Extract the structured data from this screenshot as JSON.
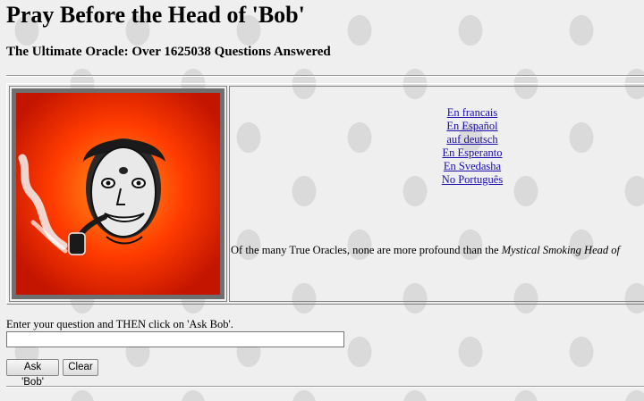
{
  "page": {
    "title": "Pray Before the Head of 'Bob'",
    "subtitle": "The Ultimate Oracle: Over 1625038 Questions Answered"
  },
  "oracle_image": {
    "icon": "smoking-bob-head",
    "colors": {
      "center": "#ff9a1e",
      "mid": "#ff3b00",
      "edge": "#c41500",
      "frame": "#6f6f6f"
    }
  },
  "languages": [
    "En francais",
    "En Español",
    "auf deutsch",
    "En Esperanto",
    "En Svedasha",
    "No Português"
  ],
  "intro": {
    "text": "Of the many True Oracles, none are more profound than the ",
    "emphasis": "Mystical Smoking Head of"
  },
  "form": {
    "prompt": "Enter your question and THEN click on 'Ask Bob'.",
    "question_value": "",
    "ask_label": "Ask 'Bob'",
    "clear_label": "Clear"
  }
}
